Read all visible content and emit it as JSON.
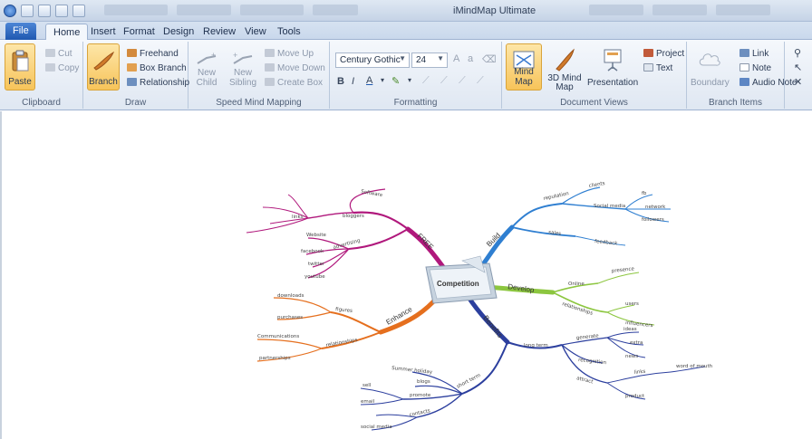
{
  "window": {
    "title": "iMindMap Ultimate"
  },
  "tabs": [
    {
      "label": "File"
    },
    {
      "label": "Home"
    },
    {
      "label": "Insert"
    },
    {
      "label": "Format"
    },
    {
      "label": "Design"
    },
    {
      "label": "Review"
    },
    {
      "label": "View"
    },
    {
      "label": "Tools"
    }
  ],
  "ribbon": {
    "clipboard": {
      "label": "Clipboard",
      "paste": "Paste",
      "cut": "Cut",
      "copy": "Copy"
    },
    "draw": {
      "label": "Draw",
      "branch": "Branch",
      "freehand": "Freehand",
      "box_branch": "Box Branch",
      "relationship": "Relationship"
    },
    "speed": {
      "label": "Speed Mind Mapping",
      "new_child": "New Child",
      "new_sibling": "New Sibling",
      "move_up": "Move Up",
      "move_down": "Move Down",
      "create_box": "Create Box"
    },
    "formatting": {
      "label": "Formatting",
      "font": "Century Gothic",
      "size": "24"
    },
    "views": {
      "label": "Document Views",
      "mind_map": "Mind Map",
      "mind_map_3d": "3D Mind Map",
      "presentation": "Presentation",
      "project": "Project",
      "text": "Text"
    },
    "branch_items": {
      "label": "Branch Items",
      "boundary": "Boundary",
      "link": "Link",
      "note": "Note",
      "audio_note": "Audio Note"
    }
  },
  "mindmap": {
    "central": "Competition",
    "branches": {
      "free": "FREE",
      "build": "Build",
      "develop": "Develop",
      "benefits": "Benefits",
      "enhance": "Enhance"
    },
    "free_sub": {
      "software": "Software",
      "bloggers": "bloggers",
      "marketing": "advertising",
      "twitter": "twitter",
      "facebook": "facebook",
      "website": "Website",
      "youtube": "youtube",
      "search": "links"
    },
    "build_sub": {
      "reputation": "reputation",
      "social": "Social media",
      "sales": "sales",
      "feedback": "feedback",
      "clients": "clients",
      "fb": "fb",
      "network": "network",
      "tw": "followers"
    },
    "develop_sub": {
      "online": "Online",
      "presence": "presence",
      "relations": "relationships",
      "users": "users",
      "influencers": "influencers"
    },
    "benefits_sub": {
      "longterm": "long term",
      "shortterm": "short term",
      "generate": "generate",
      "recognition": "recognition",
      "attract": "attract",
      "ideas": "ideas",
      "product": "product",
      "world": "word of mouth",
      "promote": "promote",
      "contacts": "contacts",
      "blogs": "blogs",
      "summer": "Summer holiday",
      "sell": "sell",
      "mail": "email",
      "mm": "social media",
      "extra": "extra",
      "news": "news",
      "links": "links"
    },
    "enhance_sub": {
      "figures": "figures",
      "downloads": "downloads",
      "purchases": "purchases",
      "relations": "relationships",
      "community": "Communications",
      "partners": "partnerships"
    }
  },
  "colors": {
    "free": "#b0187c",
    "build": "#2f7fd1",
    "develop": "#8cc63f",
    "benefits": "#2c3f9e",
    "enhance": "#e56f1e",
    "ribbon_highlight": "#f7c45a",
    "file_tab": "#1f58b0"
  }
}
